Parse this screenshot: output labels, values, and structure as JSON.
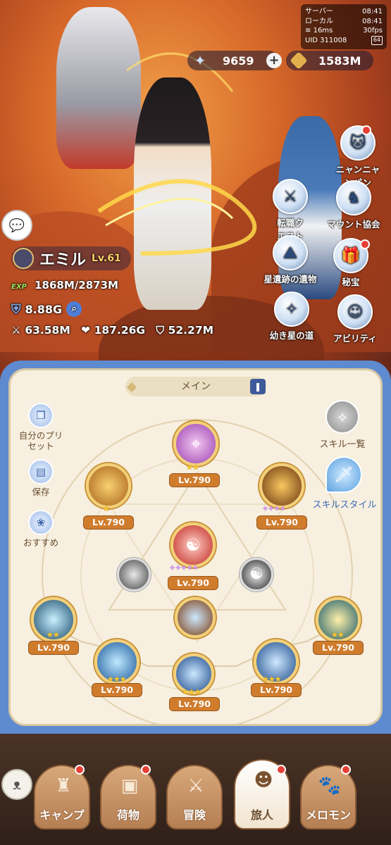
{
  "status": {
    "server_label": "サーバー",
    "server_time": "08:41",
    "local_label": "ローカル",
    "local_time": "08:41",
    "ping": "16ms",
    "fps": "30fps",
    "uid": "UID 311008",
    "battery": "64"
  },
  "resources": {
    "stars": "9659",
    "gold": "1583M"
  },
  "side_menu": [
    {
      "label": "ニャンニャンパン",
      "icon": "cat-bread-icon",
      "badge": true
    },
    {
      "label": "転職クエスト",
      "icon": "job-quest-icon",
      "badge": false
    },
    {
      "label": "マウント協会",
      "icon": "mount-icon",
      "badge": false
    },
    {
      "label": "星遺跡の遺物",
      "icon": "relic-icon",
      "badge": false
    },
    {
      "label": "秘宝",
      "icon": "treasure-icon",
      "badge": true
    },
    {
      "label": "幼き星の道",
      "icon": "star-road-icon",
      "badge": false
    },
    {
      "label": "アビリティ",
      "icon": "ability-icon",
      "badge": false
    }
  ],
  "player": {
    "name": "エミル",
    "level": "Lv.61",
    "exp_label": "EXP",
    "exp": "1868M/2873M",
    "power": "8.88G",
    "attack": "63.58M",
    "hp": "187.26G",
    "defense": "52.27M"
  },
  "skills_panel": {
    "tab_label": "メイン",
    "left_buttons": [
      {
        "label": "自分のプリセット",
        "icon": "preset-icon"
      },
      {
        "label": "保存",
        "icon": "save-icon"
      },
      {
        "label": "おすすめ",
        "icon": "recommend-icon"
      }
    ],
    "right_buttons": [
      {
        "label": "スキル一覧",
        "icon": "skill-list-icon"
      },
      {
        "label": "スキルスタイル",
        "icon": "skill-style-icon"
      }
    ],
    "skills": [
      {
        "name": "top",
        "level": "Lv.790",
        "colors": [
          "#f3c8f0",
          "#9a3fb0"
        ]
      },
      {
        "name": "upper-left",
        "level": "Lv.790",
        "colors": [
          "#f8d070",
          "#a8621a"
        ]
      },
      {
        "name": "upper-right",
        "level": "Lv.790",
        "colors": [
          "#f8c860",
          "#6a3410"
        ]
      },
      {
        "name": "center",
        "level": "Lv.790",
        "colors": [
          "#ffd0c8",
          "#c0261e"
        ]
      },
      {
        "name": "left-small",
        "level": "",
        "colors": [
          "#e8e8e8",
          "#444"
        ]
      },
      {
        "name": "right-small",
        "level": "",
        "colors": [
          "#f4f4f4",
          "#222"
        ]
      },
      {
        "name": "hub",
        "level": "",
        "colors": [
          "#cde8ff",
          "#7a3a10"
        ]
      },
      {
        "name": "far-left",
        "level": "Lv.790",
        "colors": [
          "#c8f0ff",
          "#1a4a6a"
        ]
      },
      {
        "name": "far-right",
        "level": "Lv.790",
        "colors": [
          "#fff0a8",
          "#1a5a6a"
        ]
      },
      {
        "name": "bottom-left",
        "level": "Lv.790",
        "colors": [
          "#bfe8ff",
          "#1c5a9a"
        ]
      },
      {
        "name": "bottom-center",
        "level": "Lv.790",
        "colors": [
          "#cde8ff",
          "#1c4a8a"
        ]
      },
      {
        "name": "bottom-right",
        "level": "Lv.790",
        "colors": [
          "#cde8ff",
          "#1c4a8a"
        ]
      }
    ]
  },
  "bottom_nav": [
    {
      "label": "キャンプ",
      "icon": "castle-icon",
      "badge": true
    },
    {
      "label": "荷物",
      "icon": "bag-icon",
      "badge": true
    },
    {
      "label": "冒険",
      "icon": "swords-icon",
      "badge": false
    },
    {
      "label": "旅人",
      "icon": "traveler-icon",
      "badge": true,
      "active": true
    },
    {
      "label": "メロモン",
      "icon": "pet-icon",
      "badge": true
    }
  ]
}
